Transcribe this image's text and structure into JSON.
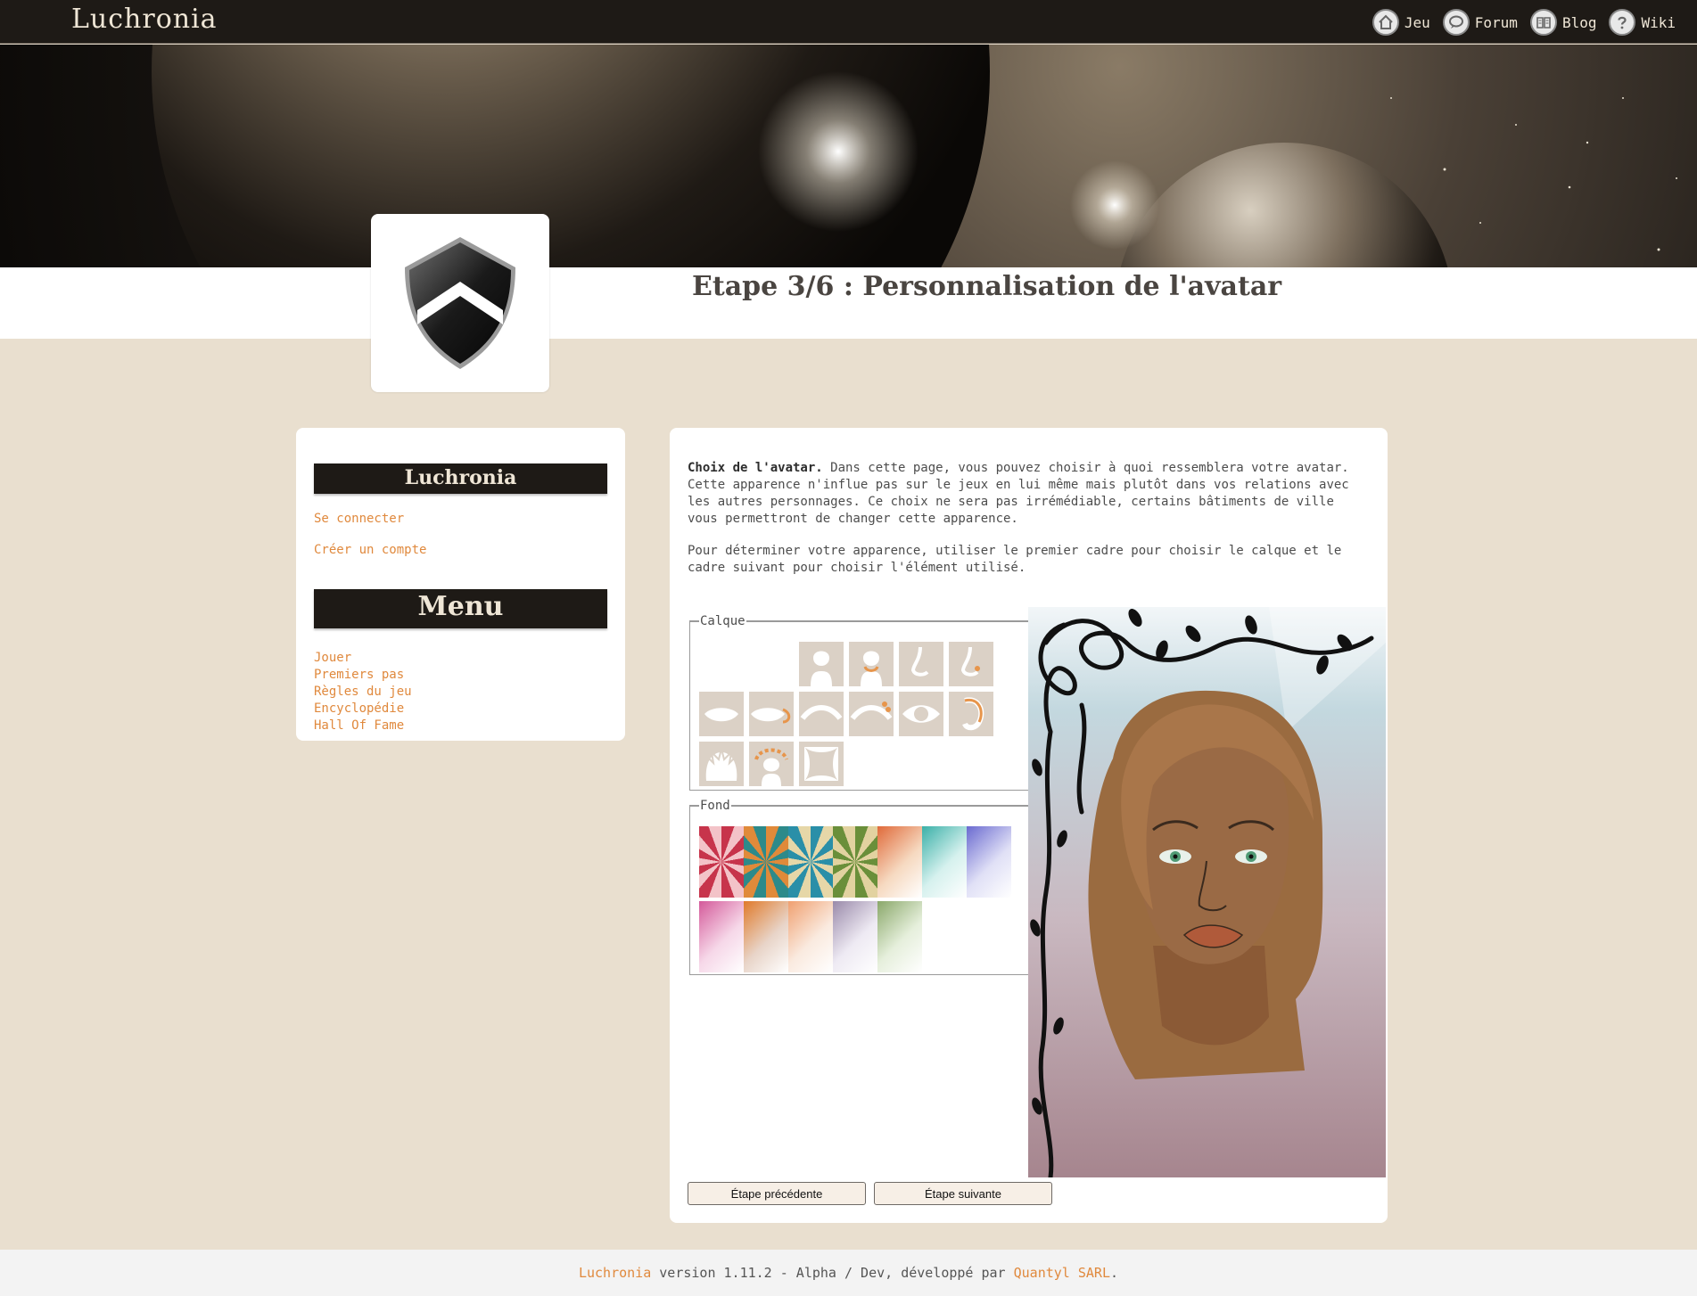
{
  "header": {
    "site_title": "Luchronia",
    "nav": [
      {
        "label": "Jeu",
        "icon": "home-icon"
      },
      {
        "label": "Forum",
        "icon": "speech-bubble-icon"
      },
      {
        "label": "Blog",
        "icon": "book-icon"
      },
      {
        "label": "Wiki",
        "icon": "question-icon"
      }
    ]
  },
  "page": {
    "title": "Etape 3/6 : Personnalisation de l'avatar"
  },
  "sidebar": {
    "heading": "Luchronia",
    "login_links": [
      "Se connecter",
      "Créer un compte"
    ],
    "menu_heading": "Menu",
    "menu_links": [
      "Jouer",
      "Premiers pas",
      "Règles du jeu",
      "Encyclopédie",
      "Hall Of Fame"
    ]
  },
  "main": {
    "intro_bold": "Choix de l'avatar.",
    "intro_text": " Dans cette page, vous pouvez choisir à quoi ressemblera votre avatar. Cette apparence n'influe pas sur le jeux en lui même mais plutôt dans vos relations avec les autres personnages. Ce choix ne sera pas irrémédiable, certains bâtiments de ville vous permettront de changer cette apparence.",
    "intro_text_2": "Pour déterminer votre apparence, utiliser le premier cadre pour choisir le calque et le cadre suivant pour choisir l'élément utilisé.",
    "calque_legend": "Calque",
    "calque_items": [
      "blank",
      "head",
      "neck",
      "nose",
      "nose-piercing",
      "lips",
      "lips-piercing",
      "eyebrow",
      "eyebrow-piercing",
      "eye",
      "ear",
      "hair",
      "hair-accessory",
      "frame"
    ],
    "fond_legend": "Fond",
    "fond_colors": [
      [
        "#c7344b",
        "#f3c3c8"
      ],
      [
        "#e08a3a",
        "#2d8a8a"
      ],
      [
        "#2a8fa8",
        "#e6d7a8"
      ],
      [
        "#6a8f3a",
        "#e2d2a0"
      ],
      [
        "#e06a3a",
        "#f6d9c0"
      ],
      [
        "#3ab0a8",
        "#d6f1ee"
      ],
      [
        "#6a6ad0",
        "#e0e0f6"
      ],
      [
        "#d45a9a",
        "#f6d7e8"
      ],
      [
        "#e07a2a",
        "#e8d4c8"
      ],
      [
        "#f0a070",
        "#faeadf"
      ],
      [
        "#9a8aaa",
        "#eeeaf3"
      ],
      [
        "#8aa86a",
        "#e6efdc"
      ]
    ],
    "prev_button": "Étape précédente",
    "next_button": "Étape suivante"
  },
  "footer": {
    "link_1": "Luchronia",
    "text_1": " version 1.11.2 - Alpha / Dev, développé par ",
    "link_2": "Quantyl SARL",
    "text_2": "."
  },
  "colors": {
    "accent": "#e0893d",
    "dark": "#1e1a16",
    "page_bg": "#e9dfcf"
  }
}
